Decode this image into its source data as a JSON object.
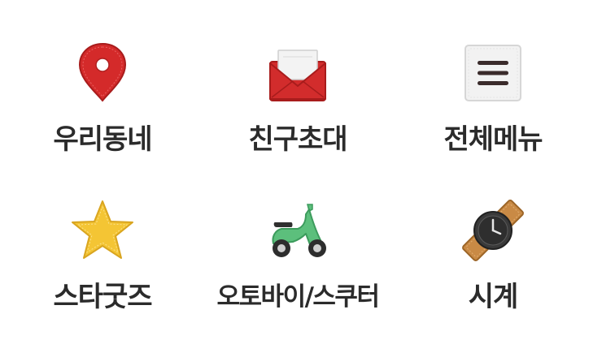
{
  "menu": {
    "items": [
      {
        "label": "우리동네",
        "icon": "location-pin-icon"
      },
      {
        "label": "친구초대",
        "icon": "envelope-icon"
      },
      {
        "label": "전체메뉴",
        "icon": "hamburger-menu-icon"
      },
      {
        "label": "스타굿즈",
        "icon": "star-icon"
      },
      {
        "label": "오토바이/스쿠터",
        "icon": "scooter-icon"
      },
      {
        "label": "시계",
        "icon": "wristwatch-icon"
      }
    ]
  },
  "colors": {
    "label_text": "#2b2b2b",
    "pin_red": "#d42a2a",
    "envelope_red": "#d22c2c",
    "star_yellow": "#f4c534",
    "scooter_green": "#5cbf7c",
    "watch_strap": "#c98a45",
    "watch_face": "#2e2e2e"
  }
}
